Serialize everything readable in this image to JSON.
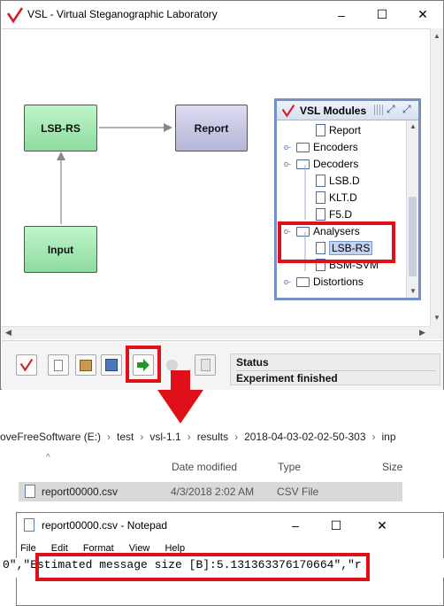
{
  "window": {
    "title": "VSL - Virtual Steganographic Laboratory",
    "minimize_glyph": "–",
    "maximize_glyph": "☐",
    "close_glyph": "✕"
  },
  "canvas": {
    "nodes": {
      "lsb_rs": "LSB-RS",
      "report": "Report",
      "input": "Input"
    }
  },
  "modules": {
    "title": "VSL Modules",
    "items": [
      {
        "label": "Report",
        "kind": "doc"
      },
      {
        "label": "Encoders",
        "kind": "folder"
      },
      {
        "label": "Decoders",
        "kind": "folder"
      },
      {
        "label": "LSB.D",
        "kind": "doc"
      },
      {
        "label": "KLT.D",
        "kind": "doc"
      },
      {
        "label": "F5.D",
        "kind": "doc"
      },
      {
        "label": "Analysers",
        "kind": "folder"
      },
      {
        "label": "LSB-RS",
        "kind": "doc",
        "selected": true
      },
      {
        "label": "BSM-SVM",
        "kind": "doc"
      },
      {
        "label": "Distortions",
        "kind": "folder"
      }
    ]
  },
  "status": {
    "label": "Status",
    "text": "Experiment finished"
  },
  "explorer": {
    "breadcrumb": [
      "oveFreeSoftware (E:)",
      "test",
      "vsl-1.1",
      "results",
      "2018-04-03-02-02-50-303",
      "inp"
    ],
    "columns": {
      "date": "Date modified",
      "type": "Type",
      "size": "Size"
    },
    "file": {
      "name": "report00000.csv",
      "date": "4/3/2018 2:02 AM",
      "type": "CSV File"
    }
  },
  "notepad": {
    "title": "report00000.csv - Notepad",
    "menu": [
      "File",
      "Edit",
      "Format",
      "View",
      "Help"
    ],
    "prefix": "0\",",
    "highlighted": "\"Estimated message size [B]:5.131363376170664\"",
    "suffix": ",\"r"
  },
  "colors": {
    "highlight_red": "#e0101a",
    "node_green": "#9be3ac",
    "node_purple": "#c6c6e4"
  }
}
